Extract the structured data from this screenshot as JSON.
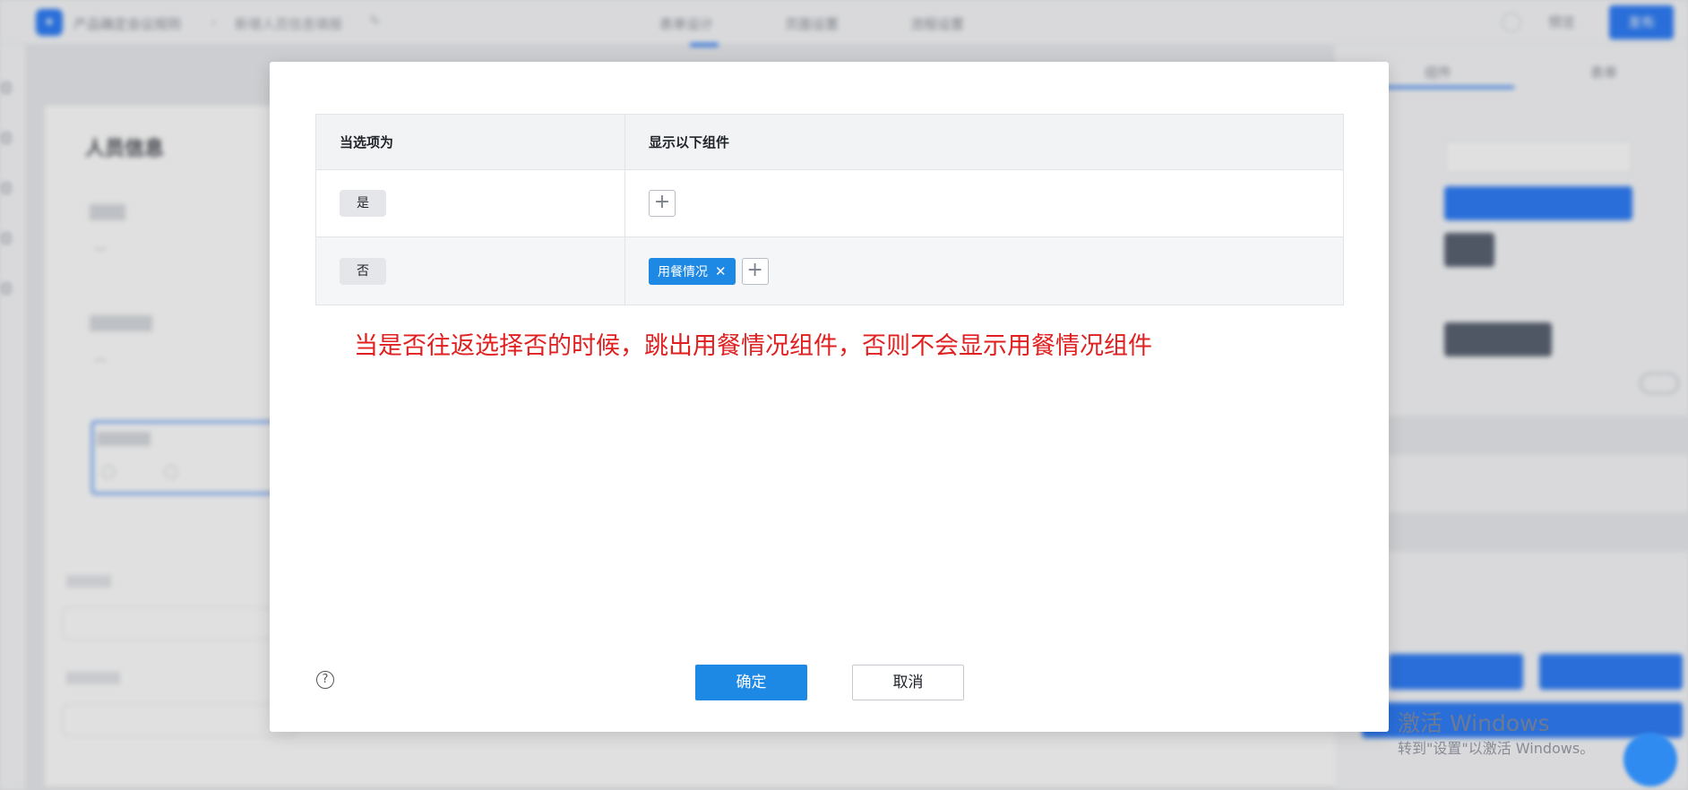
{
  "background": {
    "app_name": "产品确定会议规则",
    "form_name": "新增人员信息填报",
    "tabs": [
      "表单设计",
      "页面设置",
      "流程设置"
    ],
    "preview": "预览",
    "publish": "发布",
    "canvas_title": "人员信息",
    "right_tabs": [
      "组件",
      "表单"
    ]
  },
  "modal": {
    "table": {
      "header_option": "当选项为",
      "header_components": "显示以下组件",
      "rows": [
        {
          "option": "是",
          "components": []
        },
        {
          "option": "否",
          "components": [
            "用餐情况"
          ]
        }
      ]
    },
    "annotation": "当是否往返选择否的时候，跳出用餐情况组件，否则不会显示用餐情况组件",
    "confirm": "确定",
    "cancel": "取消",
    "help": "?"
  },
  "watermark": {
    "title": "激活 Windows",
    "subtitle": "转到\"设置\"以激活 Windows。"
  },
  "colors": {
    "primary": "#1e88e5",
    "annotation": "#e02020"
  }
}
